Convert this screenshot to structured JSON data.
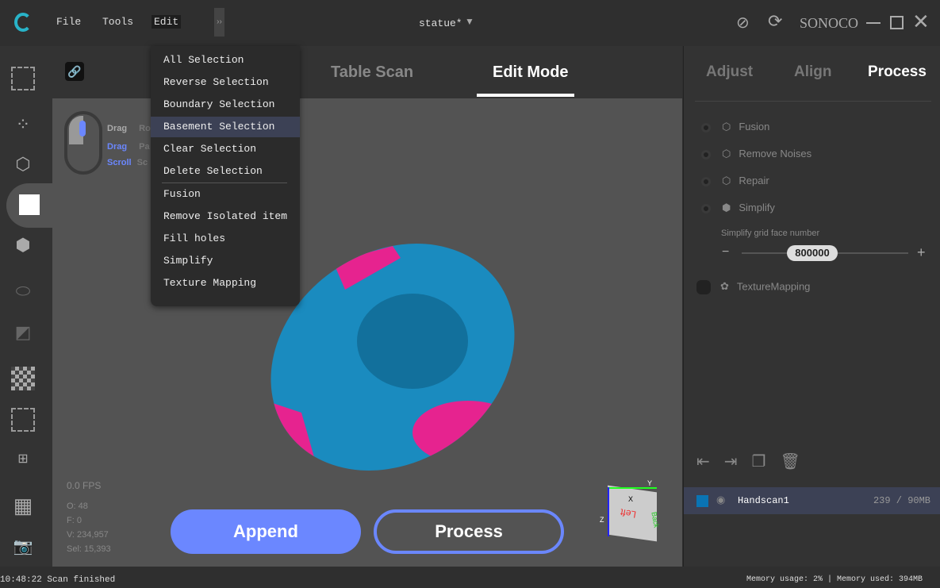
{
  "titlebar": {
    "menus": [
      "File",
      "Tools",
      "Edit"
    ],
    "file_title": "statue*",
    "brand": "SONOCO"
  },
  "edit_menu": {
    "items": [
      "All Selection",
      "Reverse Selection",
      "Boundary Selection",
      "Basement Selection",
      "Clear Selection",
      "Delete Selection",
      "Fusion",
      "Remove Isolated item",
      "Fill holes",
      "Simplify",
      "Texture Mapping"
    ],
    "highlighted": "Basement Selection"
  },
  "viewport": {
    "tabs": [
      "Table Scan",
      "Edit Mode"
    ],
    "active_tab": "Edit Mode",
    "mouse_hints": [
      {
        "action": "Drag",
        "desc": "Ro"
      },
      {
        "action": "Drag",
        "desc": "Pa"
      },
      {
        "action": "Scroll",
        "desc": "Sc"
      }
    ],
    "fps": "0.0 FPS",
    "stats": [
      "O: 48",
      "F: 0",
      "V: 234,957",
      "Sel: 15,393"
    ],
    "append_label": "Append",
    "process_label": "Process",
    "axis": {
      "x": "X",
      "y": "Y",
      "z": "Z",
      "face": "Left",
      "side": "Back"
    }
  },
  "right_panel": {
    "tabs": [
      "Adjust",
      "Align",
      "Process"
    ],
    "active_tab": "Process",
    "items": [
      "Fusion",
      "Remove Noises",
      "Repair",
      "Simplify",
      "TextureMapping"
    ],
    "slider_label": "Simplify grid face number",
    "slider_value": "800000",
    "layer": {
      "name": "Handscan1",
      "info": "239 / 90MB",
      "color": "#0a74b4"
    }
  },
  "status": {
    "message": "10:48:22 Scan finished",
    "memory": "Memory usage: 2% | Memory used: 394MB"
  },
  "colors": {
    "accent": "#6b87ff",
    "mesh": "#1a8bbf",
    "selection": "#e6238f"
  }
}
